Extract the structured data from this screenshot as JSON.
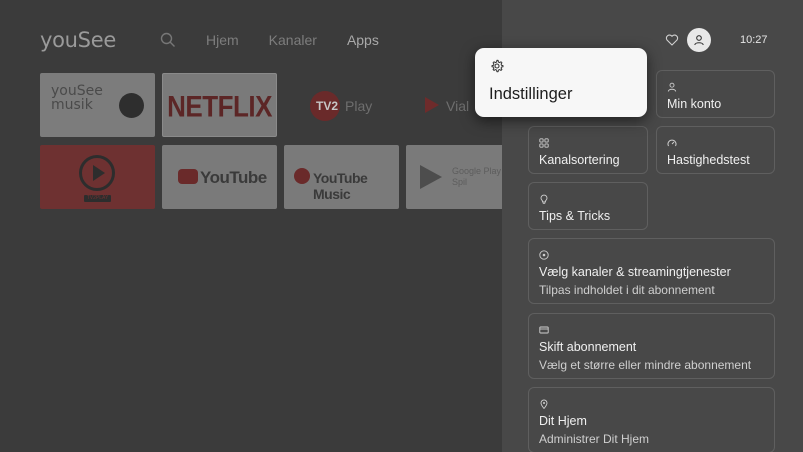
{
  "app": {
    "logo": "youSee",
    "nav": [
      {
        "label": "Hjem",
        "active": false
      },
      {
        "label": "Kanaler",
        "active": false
      },
      {
        "label": "Apps",
        "active": true
      }
    ]
  },
  "tiles": {
    "musik": "youSee\nmusik",
    "netflix": "NETFLIX",
    "tv2": "Play",
    "tv2_logo": "TV2",
    "viaplay": "Vial",
    "tv2play_badge": "TV2PLAY",
    "youtube": "YouTube",
    "ytmusic": "YouTube Music",
    "gplay": "Google Play Spil"
  },
  "status": {
    "clock": "10:27"
  },
  "settings": {
    "focused": {
      "label": "Indstillinger",
      "icon": "gear-icon"
    },
    "cards": {
      "konto": {
        "label": "Min konto",
        "icon": "user-icon"
      },
      "kanal": {
        "label": "Kanalsortering",
        "icon": "grid-icon"
      },
      "hast": {
        "label": "Hastighedstest",
        "icon": "speedometer-icon"
      },
      "tips": {
        "label": "Tips & Tricks",
        "icon": "lightbulb-icon"
      },
      "vaelg": {
        "label": "Vælg kanaler & streamingtjenester",
        "sub": "Tilpas indholdet i dit abonnement",
        "icon": "plus-circle-icon"
      },
      "skift": {
        "label": "Skift abonnement",
        "sub": "Vælg et større eller mindre abonnement",
        "icon": "card-icon"
      },
      "hjem": {
        "label": "Dit Hjem",
        "sub": "Administrer Dit Hjem",
        "icon": "location-pin-icon"
      }
    }
  },
  "colors": {
    "panel": "#484848",
    "background": "#3b3b3b",
    "focus": "#f7f7f7"
  }
}
